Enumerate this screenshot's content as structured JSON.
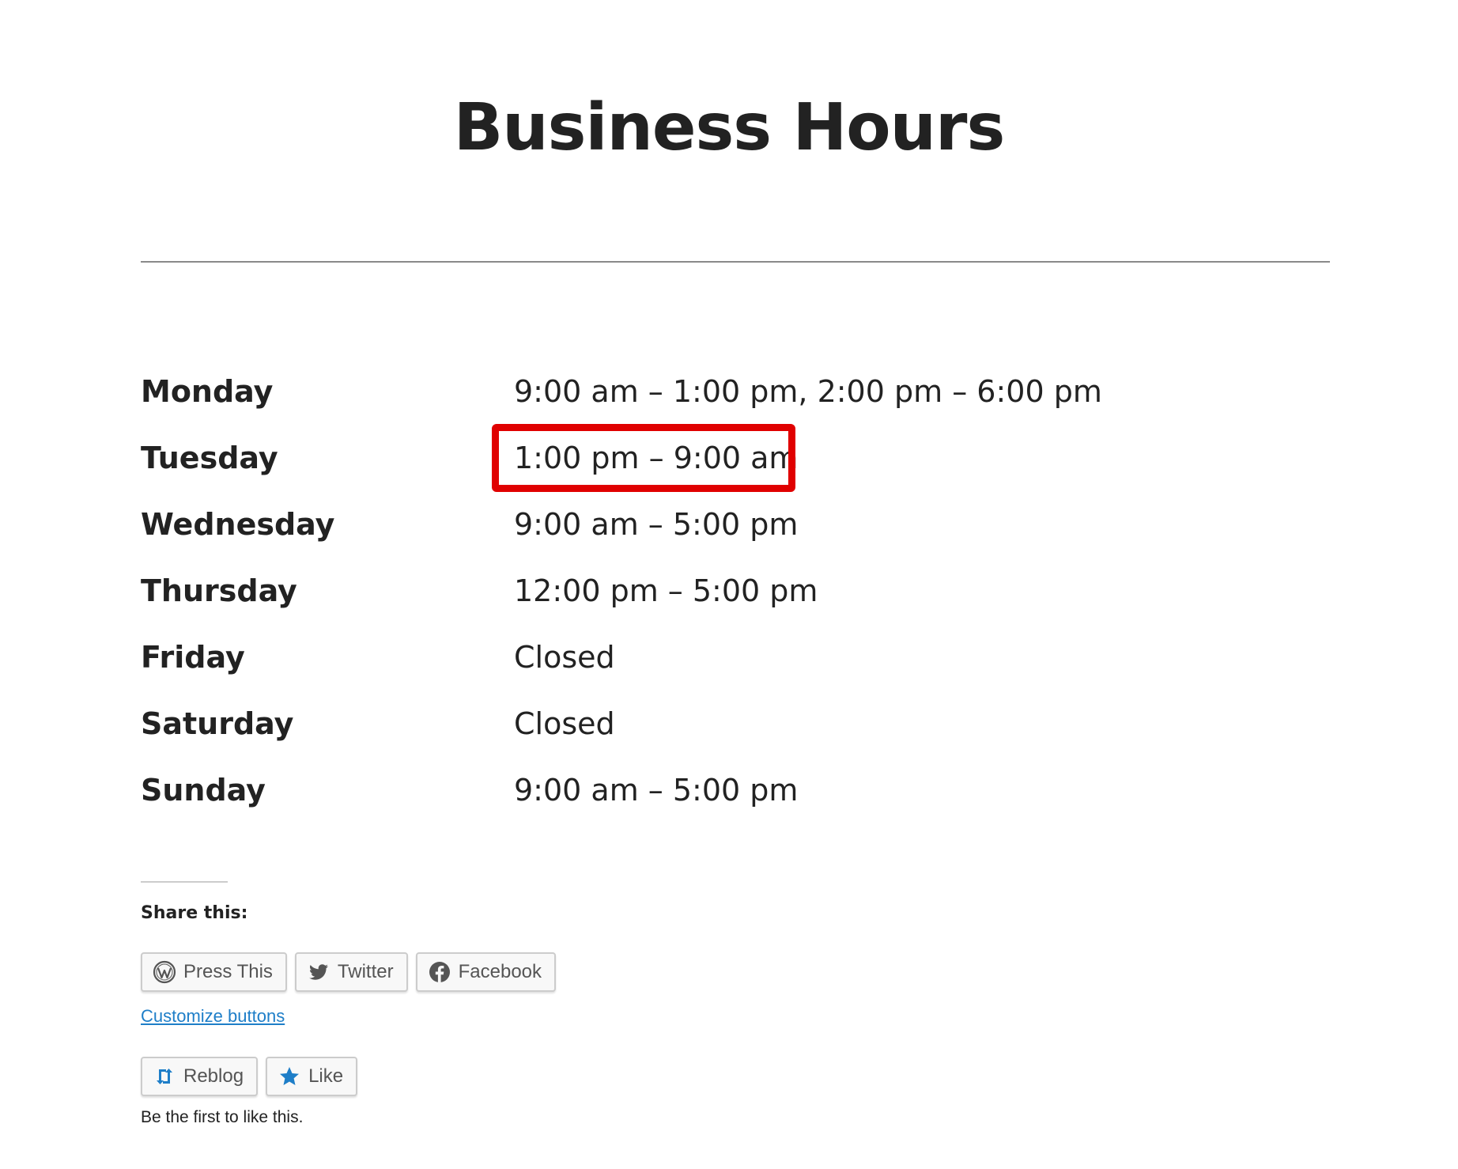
{
  "page": {
    "title": "Business Hours"
  },
  "hours": [
    {
      "day": "Monday",
      "hours": "9:00 am – 1:00 pm, 2:00 pm – 6:00 pm"
    },
    {
      "day": "Tuesday",
      "hours": "1:00 pm – 9:00 am"
    },
    {
      "day": "Wednesday",
      "hours": "9:00 am – 5:00 pm"
    },
    {
      "day": "Thursday",
      "hours": "12:00 pm – 5:00 pm"
    },
    {
      "day": "Friday",
      "hours": "Closed"
    },
    {
      "day": "Saturday",
      "hours": "Closed"
    },
    {
      "day": "Sunday",
      "hours": "9:00 am – 5:00 pm"
    }
  ],
  "highlight": {
    "color": "#e00000"
  },
  "share": {
    "heading": "Share this:",
    "buttons": [
      {
        "label": "Press This",
        "icon": "wordpress-icon"
      },
      {
        "label": "Twitter",
        "icon": "twitter-icon"
      },
      {
        "label": "Facebook",
        "icon": "facebook-icon"
      }
    ],
    "customize_label": "Customize buttons"
  },
  "actions": {
    "reblog_label": "Reblog",
    "like_label": "Like",
    "likes_text": "Be the first to like this."
  },
  "colors": {
    "link": "#1e7ec8",
    "accent_icon": "#1e7ec8"
  }
}
